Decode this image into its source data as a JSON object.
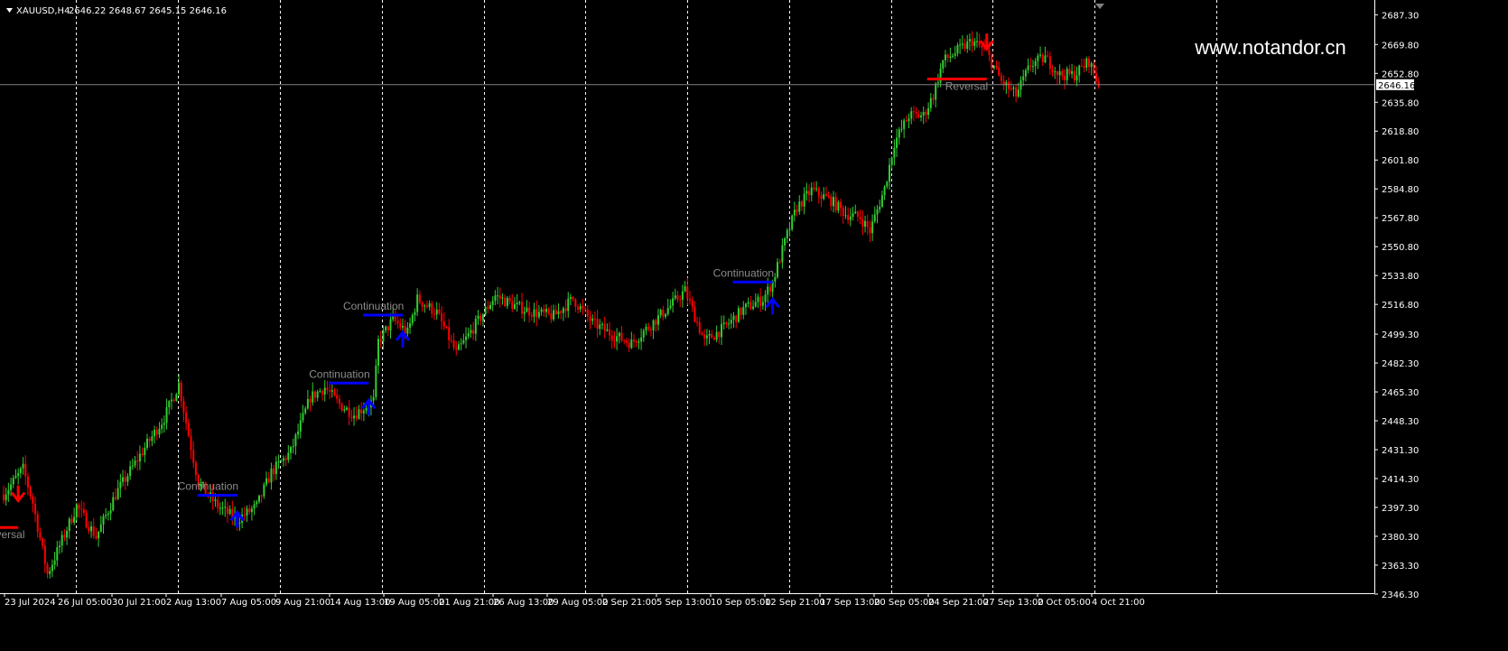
{
  "window": {
    "symbol": "XAUUSD,H4",
    "ohlc": "2646.22 2648.67 2645.15 2646.16",
    "watermark": "www.notandor.cn",
    "current_price_label": "2646.16"
  },
  "colors": {
    "background": "#000000",
    "bull": "#32cd32",
    "bear": "#ff0000",
    "grid": "#ffffff",
    "price_line": "#808080",
    "signal_up": "#0000ff",
    "signal_down": "#ff0000",
    "signal_text": "#8c8c8c"
  },
  "chart_data": {
    "type": "candlestick",
    "ylim": [
      2346.8,
      2696.0
    ],
    "current_price": 2646.16,
    "y_ticks": [
      "2687.30",
      "2669.80",
      "2652.80",
      "2635.80",
      "2618.80",
      "2601.80",
      "2584.80",
      "2567.80",
      "2550.80",
      "2533.80",
      "2516.80",
      "2499.30",
      "2482.30",
      "2465.30",
      "2448.30",
      "2431.30",
      "2414.30",
      "2397.30",
      "2380.30",
      "2363.30",
      "2346.30"
    ],
    "x_ticks": [
      "23 Jul 2024",
      "26 Jul 05:00",
      "30 Jul 21:00",
      "2 Aug 13:00",
      "7 Aug 05:00",
      "9 Aug 21:00",
      "14 Aug 13:00",
      "19 Aug 05:00",
      "21 Aug 21:00",
      "26 Aug 13:00",
      "29 Aug 05:00",
      "2 Sep 21:00",
      "5 Sep 13:00",
      "10 Sep 05:00",
      "12 Sep 21:00",
      "17 Sep 13:00",
      "20 Sep 05:00",
      "24 Sep 21:00",
      "27 Sep 13:00",
      "2 Oct 05:00",
      "4 Oct 21:00"
    ],
    "waypoints": [
      [
        0,
        2405
      ],
      [
        8,
        2420
      ],
      [
        12,
        2400
      ],
      [
        18,
        2358
      ],
      [
        24,
        2378
      ],
      [
        30,
        2398
      ],
      [
        38,
        2380
      ],
      [
        46,
        2405
      ],
      [
        56,
        2428
      ],
      [
        66,
        2450
      ],
      [
        72,
        2470
      ],
      [
        76,
        2440
      ],
      [
        80,
        2412
      ],
      [
        88,
        2398
      ],
      [
        96,
        2390
      ],
      [
        104,
        2398
      ],
      [
        110,
        2418
      ],
      [
        118,
        2430
      ],
      [
        126,
        2462
      ],
      [
        132,
        2468
      ],
      [
        138,
        2458
      ],
      [
        144,
        2452
      ],
      [
        152,
        2460
      ],
      [
        154,
        2495
      ],
      [
        160,
        2508
      ],
      [
        166,
        2500
      ],
      [
        170,
        2520
      ],
      [
        178,
        2512
      ],
      [
        186,
        2488
      ],
      [
        194,
        2505
      ],
      [
        202,
        2522
      ],
      [
        210,
        2516
      ],
      [
        218,
        2512
      ],
      [
        226,
        2510
      ],
      [
        234,
        2520
      ],
      [
        242,
        2506
      ],
      [
        250,
        2499
      ],
      [
        258,
        2494
      ],
      [
        266,
        2505
      ],
      [
        274,
        2516
      ],
      [
        280,
        2525
      ],
      [
        288,
        2495
      ],
      [
        296,
        2503
      ],
      [
        304,
        2514
      ],
      [
        312,
        2520
      ],
      [
        316,
        2530
      ],
      [
        322,
        2558
      ],
      [
        326,
        2574
      ],
      [
        332,
        2584
      ],
      [
        340,
        2578
      ],
      [
        346,
        2570
      ],
      [
        352,
        2568
      ],
      [
        356,
        2560
      ],
      [
        362,
        2585
      ],
      [
        366,
        2612
      ],
      [
        372,
        2628
      ],
      [
        378,
        2628
      ],
      [
        382,
        2640
      ],
      [
        386,
        2660
      ],
      [
        392,
        2666
      ],
      [
        398,
        2672
      ],
      [
        404,
        2665
      ],
      [
        410,
        2648
      ],
      [
        416,
        2640
      ],
      [
        422,
        2658
      ],
      [
        428,
        2662
      ],
      [
        434,
        2652
      ],
      [
        440,
        2652
      ],
      [
        446,
        2660
      ],
      [
        450,
        2646
      ]
    ],
    "signals": [
      {
        "type": "down",
        "label": "Reversal",
        "index": 6,
        "level": 2385.5
      },
      {
        "type": "up",
        "label": "Continuation",
        "index": 96,
        "level": 2404.5
      },
      {
        "type": "up",
        "label": "Continuation",
        "index": 150,
        "level": 2470.5
      },
      {
        "type": "up",
        "label": "Continuation",
        "index": 164,
        "level": 2510.5
      },
      {
        "type": "up",
        "label": "Continuation",
        "index": 316,
        "level": 2530.0
      },
      {
        "type": "down",
        "label": "Reversal",
        "index": 404,
        "level": 2649.5
      }
    ]
  }
}
